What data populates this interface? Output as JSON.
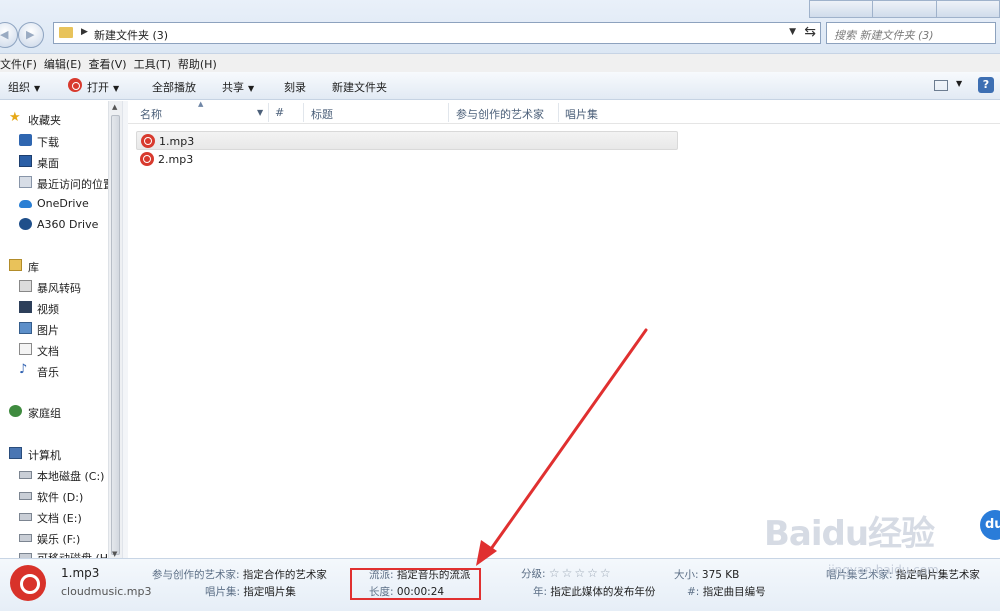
{
  "address": {
    "path": "新建文件夹 (3)",
    "search_placeholder": "搜索 新建文件夹 (3)"
  },
  "menu": [
    "文件(F)",
    "编辑(E)",
    "查看(V)",
    "工具(T)",
    "帮助(H)"
  ],
  "toolbar": {
    "organize": "组织",
    "open": "打开",
    "play_all": "全部播放",
    "share": "共享",
    "burn": "刻录",
    "new_folder": "新建文件夹",
    "help_icon": "help-icon"
  },
  "nav": {
    "favorites": "收藏夹",
    "downloads": "下载",
    "desktop": "桌面",
    "recent": "最近访问的位置",
    "onedrive": "OneDrive",
    "a360": "A360 Drive",
    "libraries": "库",
    "lib_item": "暴风转码",
    "videos": "视频",
    "pictures": "图片",
    "documents": "文档",
    "music": "音乐",
    "homegroup": "家庭组",
    "computer": "计算机",
    "drive_c": "本地磁盘 (C:)",
    "drive_d": "软件 (D:)",
    "drive_e": "文档 (E:)",
    "drive_f": "娱乐 (F:)",
    "drive_h": "可移动磁盘 (H"
  },
  "columns": {
    "name": "名称",
    "number": "#",
    "title": "标题",
    "artist": "参与创作的艺术家",
    "album": "唱片集"
  },
  "files": [
    {
      "name": "1.mp3",
      "selected": true
    },
    {
      "name": "2.mp3",
      "selected": false
    }
  ],
  "details": {
    "filename": "1.mp3",
    "type": "cloudmusic.mp3",
    "artist_label": "参与创作的艺术家:",
    "artist_value": "指定合作的艺术家",
    "album_label": "唱片集:",
    "album_value": "指定唱片集",
    "genre_label": "流派:",
    "genre_value": "指定音乐的流派",
    "length_label": "长度:",
    "length_value": "00:00:24",
    "rating_label": "分级:",
    "rating_stars": "☆☆☆☆☆",
    "rating": 0,
    "year_label": "年:",
    "year_value": "指定此媒体的发布年份",
    "size_label": "大小:",
    "size_value": "375 KB",
    "track_label": "#:",
    "track_value": "指定曲目编号",
    "album_artist_label": "唱片集艺术家:",
    "album_artist_value": "指定唱片集艺术家"
  },
  "watermark": {
    "logo": "Baidu经验",
    "url": "jingyan.baidu.com",
    "bubble": "du"
  },
  "colors": {
    "netease_red": "#d83a2e",
    "highlight_red": "#e03030",
    "toolbar_blue": "#dce7f4"
  }
}
